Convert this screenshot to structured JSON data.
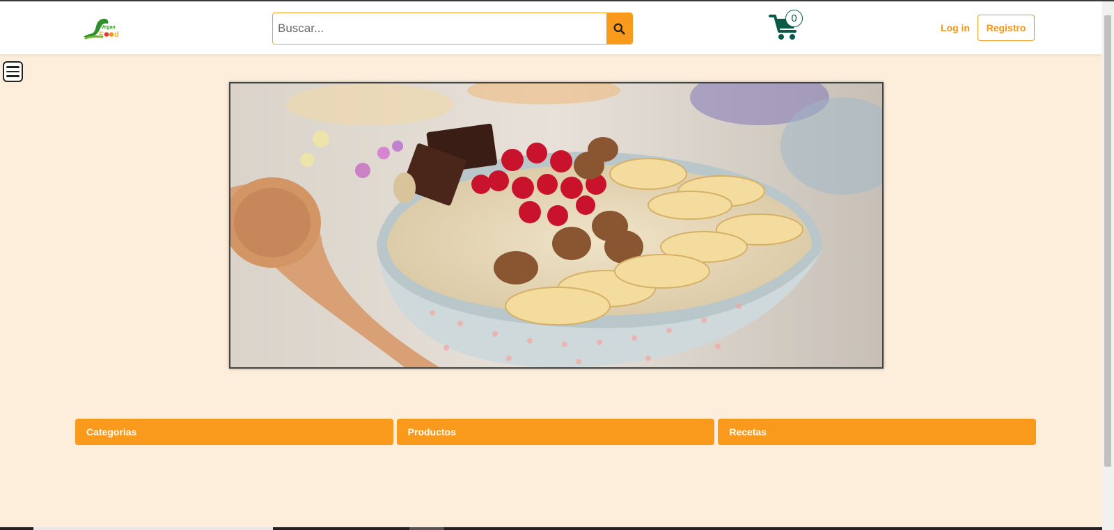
{
  "header": {
    "logo_alt": "Vegan Food",
    "logo_top_text": "Vegan",
    "logo_bottom_text": "Food",
    "search_placeholder": "Buscar...",
    "cart_count": "0",
    "login_label": "Log in",
    "register_label": "Registro"
  },
  "hero": {
    "image_alt": "Porridge bowl with pomegranate, hazelnuts, banana and chocolate"
  },
  "tabs": [
    {
      "label": "Categorias"
    },
    {
      "label": "Productos"
    },
    {
      "label": "Recetas"
    }
  ],
  "colors": {
    "accent": "#f99a1c",
    "background": "#fdeedb",
    "cart": "#0b5a48"
  },
  "icons": {
    "search": "search-icon",
    "cart": "cart-icon",
    "menu": "hamburger-menu-icon"
  }
}
